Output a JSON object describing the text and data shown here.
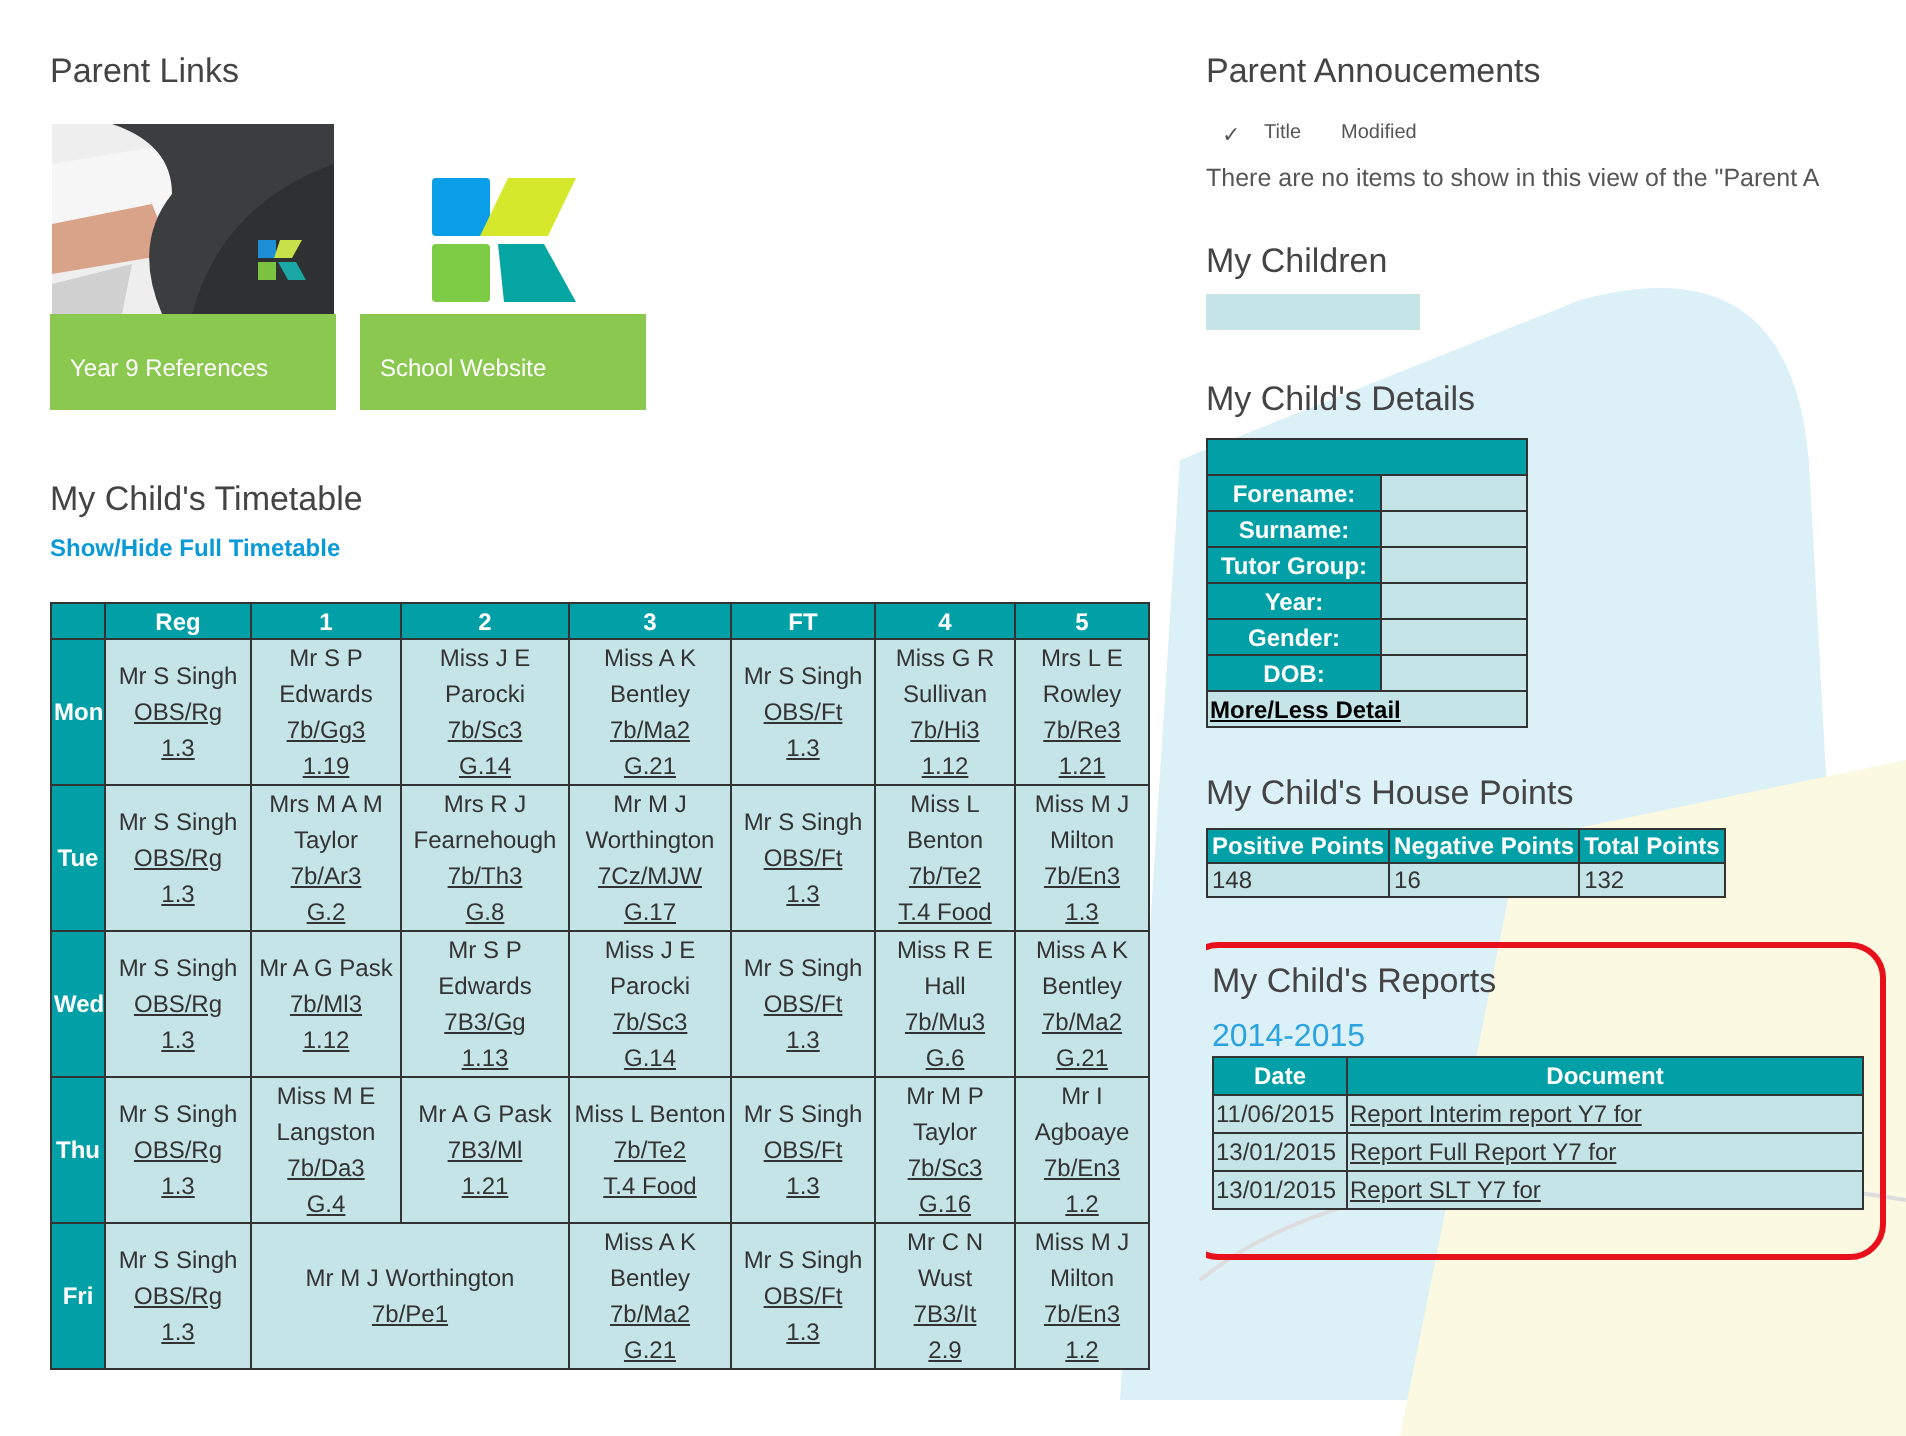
{
  "parent_links": {
    "title": "Parent Links",
    "tiles": [
      {
        "label": "Year 9 References"
      },
      {
        "label": "School Website",
        "kind": "logo"
      }
    ]
  },
  "timetable": {
    "title": "My Child's Timetable",
    "toggle_link": "Show/Hide Full Timetable",
    "columns": [
      "Reg",
      "1",
      "2",
      "3",
      "FT",
      "4",
      "5"
    ],
    "rows": [
      {
        "day": "Mon",
        "cells": [
          {
            "teacher": "Mr S Singh",
            "class": "OBS/Rg",
            "room": "1.3"
          },
          {
            "teacher": "Mr S P Edwards",
            "class": "7b/Gg3",
            "room": "1.19"
          },
          {
            "teacher": "Miss J E Parocki",
            "class": "7b/Sc3",
            "room": "G.14"
          },
          {
            "teacher": "Miss A K Bentley",
            "class": "7b/Ma2",
            "room": "G.21"
          },
          {
            "teacher": "Mr S Singh",
            "class": "OBS/Ft",
            "room": "1.3"
          },
          {
            "teacher": "Miss G R Sullivan",
            "class": "7b/Hi3",
            "room": "1.12"
          },
          {
            "teacher": "Mrs L E Rowley",
            "class": "7b/Re3",
            "room": "1.21"
          }
        ]
      },
      {
        "day": "Tue",
        "cells": [
          {
            "teacher": "Mr S Singh",
            "class": "OBS/Rg",
            "room": "1.3"
          },
          {
            "teacher": "Mrs M A M Taylor",
            "class": "7b/Ar3",
            "room": "G.2"
          },
          {
            "teacher": "Mrs R J Fearnehough",
            "class": "7b/Th3",
            "room": "G.8"
          },
          {
            "teacher": "Mr M J Worthington",
            "class": "7Cz/MJW",
            "room": "G.17"
          },
          {
            "teacher": "Mr S Singh",
            "class": "OBS/Ft",
            "room": "1.3"
          },
          {
            "teacher": "Miss L Benton",
            "class": "7b/Te2",
            "room": "T.4 Food"
          },
          {
            "teacher": "Miss M J Milton",
            "class": "7b/En3",
            "room": "1.3"
          }
        ]
      },
      {
        "day": "Wed",
        "cells": [
          {
            "teacher": "Mr S Singh",
            "class": "OBS/Rg",
            "room": "1.3"
          },
          {
            "teacher": "Mr A G Pask",
            "class": "7b/Ml3",
            "room": "1.12"
          },
          {
            "teacher": "Mr S P Edwards",
            "class": "7B3/Gg",
            "room": "1.13"
          },
          {
            "teacher": "Miss J E Parocki",
            "class": "7b/Sc3",
            "room": "G.14"
          },
          {
            "teacher": "Mr S Singh",
            "class": "OBS/Ft",
            "room": "1.3"
          },
          {
            "teacher": "Miss R E Hall",
            "class": "7b/Mu3",
            "room": "G.6"
          },
          {
            "teacher": "Miss A K Bentley",
            "class": "7b/Ma2",
            "room": "G.21"
          }
        ]
      },
      {
        "day": "Thu",
        "cells": [
          {
            "teacher": "Mr S Singh",
            "class": "OBS/Rg",
            "room": "1.3"
          },
          {
            "teacher": "Miss M E Langston",
            "class": "7b/Da3",
            "room": "G.4"
          },
          {
            "teacher": "Mr A G Pask",
            "class": "7B3/Ml",
            "room": "1.21"
          },
          {
            "teacher": "Miss L Benton",
            "class": "7b/Te2",
            "room": "T.4 Food"
          },
          {
            "teacher": "Mr S Singh",
            "class": "OBS/Ft",
            "room": "1.3"
          },
          {
            "teacher": "Mr M P Taylor",
            "class": "7b/Sc3",
            "room": "G.16"
          },
          {
            "teacher": "Mr I Agboaye",
            "class": "7b/En3",
            "room": "1.2"
          }
        ]
      },
      {
        "day": "Fri",
        "cells": [
          {
            "teacher": "Mr S Singh",
            "class": "OBS/Rg",
            "room": "1.3"
          },
          {
            "colspan": 2,
            "teacher": "Mr M J Worthington",
            "class": "7b/Pe1"
          },
          {
            "teacher": "Miss A K Bentley",
            "class": "7b/Ma2",
            "room": "G.21"
          },
          {
            "teacher": "Mr S Singh",
            "class": "OBS/Ft",
            "room": "1.3"
          },
          {
            "teacher": "Mr C N Wust",
            "class": "7B3/It",
            "room": "2.9"
          },
          {
            "teacher": "Miss M J Milton",
            "class": "7b/En3",
            "room": "1.2"
          }
        ]
      }
    ]
  },
  "announcements": {
    "title": "Parent Annoucements",
    "check_mark": "✓",
    "list_columns": [
      "Title",
      "Modified"
    ],
    "empty_message": "There are no items to show in this view of the \"Parent A"
  },
  "children": {
    "title": "My Children"
  },
  "details": {
    "title": "My Child's Details",
    "fields": [
      "Forename:",
      "Surname:",
      "Tutor Group:",
      "Year:",
      "Gender:",
      "DOB:"
    ],
    "toggle_link": "More/Less Detail"
  },
  "house_points": {
    "title": "My Child's House Points",
    "columns": [
      "Positive Points",
      "Negative Points",
      "Total Points"
    ],
    "values": [
      "148",
      "16",
      "132"
    ]
  },
  "reports": {
    "title": "My Child's Reports",
    "highlighted": true,
    "columns": [
      "Date",
      "Document"
    ],
    "years": [
      {
        "year": "2014-2015",
        "rows": [
          {
            "date": "11/06/2015",
            "document": "Report Interim report Y7 for"
          },
          {
            "date": "13/01/2015",
            "document": "Report Full Report Y7 for"
          },
          {
            "date": "13/01/2015",
            "document": "Report SLT Y7 for"
          }
        ]
      }
    ]
  }
}
